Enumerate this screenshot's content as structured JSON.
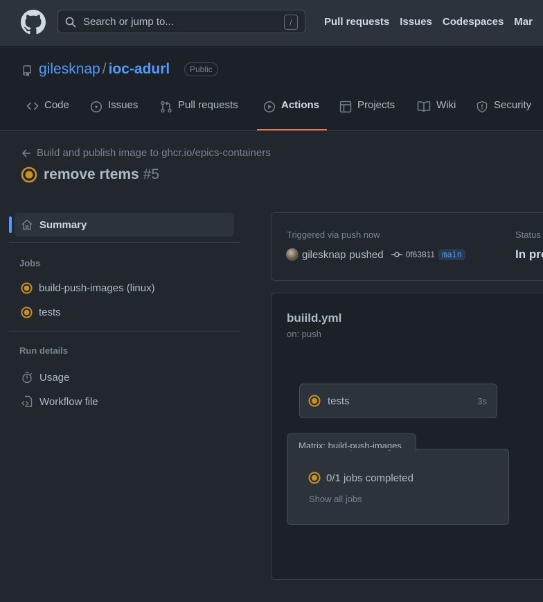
{
  "header": {
    "search_placeholder": "Search or jump to...",
    "search_shortcut": "/",
    "nav": [
      "Pull requests",
      "Issues",
      "Codespaces",
      "Mar"
    ]
  },
  "repo": {
    "owner": "gilesknap",
    "separator": "/",
    "name": "ioc-adurl",
    "visibility": "Public"
  },
  "tabs": [
    {
      "label": "Code",
      "icon": "code-icon"
    },
    {
      "label": "Issues",
      "icon": "issue-opened-icon"
    },
    {
      "label": "Pull requests",
      "icon": "git-pull-request-icon"
    },
    {
      "label": "Actions",
      "icon": "play-icon",
      "active": true
    },
    {
      "label": "Projects",
      "icon": "table-icon"
    },
    {
      "label": "Wiki",
      "icon": "book-icon"
    },
    {
      "label": "Security",
      "icon": "shield-icon"
    }
  ],
  "run": {
    "back_label": "Build and publish image to ghcr.io/epics-containers",
    "title": "remove rtems",
    "number": "#5"
  },
  "sidebar": {
    "summary_label": "Summary",
    "jobs_heading": "Jobs",
    "jobs": [
      "build-push-images (linux)",
      "tests"
    ],
    "run_details_heading": "Run details",
    "details": [
      "Usage",
      "Workflow file"
    ]
  },
  "status": {
    "triggered_label": "Triggered via push now",
    "pusher": "gilesknap",
    "action": "pushed",
    "commit_sha": "0f63811",
    "branch": "main",
    "status_label": "Status",
    "status_value": "In pro"
  },
  "workflow": {
    "file": "buiild.yml",
    "trigger": "on: push",
    "job": {
      "name": "tests",
      "duration": "3s"
    },
    "matrix": {
      "label": "Matrix: build-push-images",
      "completed": "0/1 jobs completed",
      "show_all": "Show all jobs"
    }
  },
  "colors": {
    "in_progress": "#c69026",
    "accent": "#539bf5",
    "tab_underline": "#ec775c"
  }
}
